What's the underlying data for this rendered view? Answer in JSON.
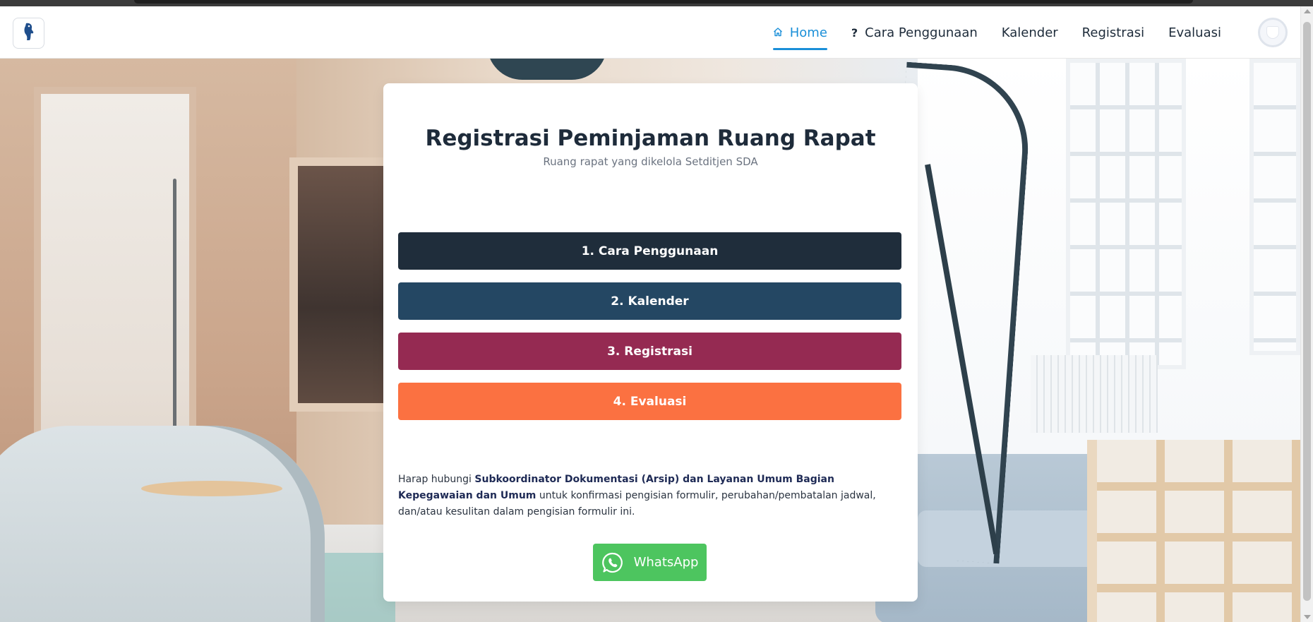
{
  "nav": {
    "logo_icon": "horse-logo-icon",
    "items": [
      {
        "label": "Home",
        "icon": "home-icon",
        "active": true
      },
      {
        "label": "Cara Penggunaan",
        "icon": "question-icon",
        "active": false
      },
      {
        "label": "Kalender",
        "icon": "",
        "active": false
      },
      {
        "label": "Registrasi",
        "icon": "",
        "active": false
      },
      {
        "label": "Evaluasi",
        "icon": "",
        "active": false
      }
    ],
    "active_color": "#1a8fd8"
  },
  "card": {
    "title": "Registrasi Peminjaman Ruang Rapat",
    "subtitle": "Ruang rapat yang dikelola Setditjen SDA",
    "steps": [
      {
        "label": "1. Cara Penggunaan",
        "color": "#1f2d3b"
      },
      {
        "label": "2. Kalender",
        "color": "#244763"
      },
      {
        "label": "3. Registrasi",
        "color": "#952a52"
      },
      {
        "label": "4. Evaluasi",
        "color": "#fb7141"
      }
    ],
    "note": {
      "prefix": "Harap hubungi ",
      "strong": "Subkoordinator Dokumentasi (Arsip) dan Layanan Umum Bagian Kepegawaian dan Umum",
      "suffix": " untuk konfirmasi pengisian formulir, perubahan/pembatalan jadwal, dan/atau kesulitan dalam pengisian formulir ini."
    },
    "whatsapp": {
      "label": "WhatsApp",
      "icon": "whatsapp-icon",
      "color": "#4dc55f"
    }
  }
}
